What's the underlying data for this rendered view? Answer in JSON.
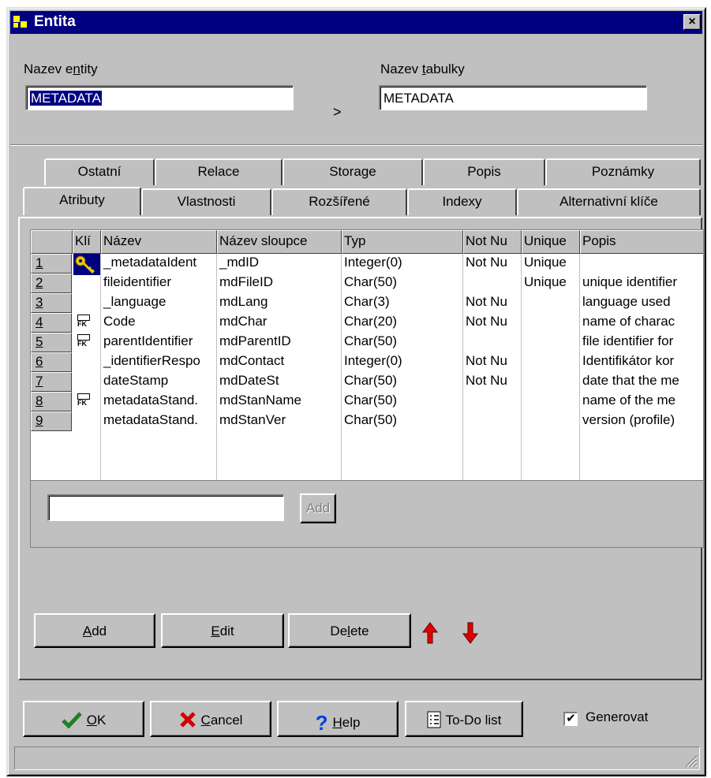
{
  "window": {
    "title": "Entita",
    "close": "×"
  },
  "form": {
    "entity_label_pre": "Nazev e",
    "entity_label_key": "n",
    "entity_label_post": "tity",
    "entity_value": "METADATA",
    "table_label_pre": "Nazev ",
    "table_label_key": "t",
    "table_label_post": "abulky",
    "table_value": "METADATA",
    "arrow": ">"
  },
  "tabs_row1": [
    "Ostatní",
    "Relace",
    "Storage",
    "Popis",
    "Poznámky"
  ],
  "tabs_row2": [
    "Atributy",
    "Vlastnosti",
    "Rozšířené",
    "Indexy",
    "Alternativní klíče"
  ],
  "grid": {
    "headers": [
      "Klí",
      "Název",
      "Název sloupce",
      "Typ",
      "Not Nu",
      "Unique",
      "Popis"
    ],
    "rows": [
      {
        "n": "1",
        "name": "_metadataIdent",
        "col": "_mdID",
        "type": "Integer(0)",
        "notnull": "Not Nu",
        "unique": "Unique",
        "desc": ""
      },
      {
        "n": "2",
        "name": "fileidentifier",
        "col": "mdFileID",
        "type": "Char(50)",
        "notnull": "",
        "unique": "Unique",
        "desc": "unique identifier"
      },
      {
        "n": "3",
        "name": "_language",
        "col": "mdLang",
        "type": "Char(3)",
        "notnull": "Not Nu",
        "unique": "",
        "desc": "language used"
      },
      {
        "n": "4",
        "name": "Code",
        "col": "mdChar",
        "type": "Char(20)",
        "notnull": "Not Nu",
        "unique": "",
        "desc": "name of charac"
      },
      {
        "n": "5",
        "name": "parentIdentifier",
        "col": "mdParentID",
        "type": "Char(50)",
        "notnull": "",
        "unique": "",
        "desc": "file identifier for"
      },
      {
        "n": "6",
        "name": "_identifierRespo",
        "col": "mdContact",
        "type": "Integer(0)",
        "notnull": "Not Nu",
        "unique": "",
        "desc": "Identifikátor kor"
      },
      {
        "n": "7",
        "name": "dateStamp",
        "col": "mdDateSt",
        "type": "Char(50)",
        "notnull": "Not Nu",
        "unique": "",
        "desc": "date that the me"
      },
      {
        "n": "8",
        "name": "metadataStand.",
        "col": "mdStanName",
        "type": "Char(50)",
        "notnull": "",
        "unique": "",
        "desc": "name of the me"
      },
      {
        "n": "9",
        "name": "metadataStand.",
        "col": "mdStanVer",
        "type": "Char(50)",
        "notnull": "",
        "unique": "",
        "desc": "version (profile)"
      }
    ],
    "fk_label": "FK",
    "quick_add_value": "",
    "quick_add_button": "Add"
  },
  "actions": {
    "add_pre": "",
    "add_key": "A",
    "add_post": "dd",
    "edit_pre": "",
    "edit_key": "E",
    "edit_post": "dit",
    "delete_pre": "De",
    "delete_key": "l",
    "delete_post": "ete"
  },
  "footer": {
    "ok_key": "O",
    "ok_post": "K",
    "cancel_key": "C",
    "cancel_post": "ancel",
    "help_key": "H",
    "help_post": "elp",
    "todo": "To-Do list",
    "generate_label": "Generovat",
    "generate_checked": "✔"
  },
  "colors": {
    "titlebar": "#000080",
    "face": "#c0c0c0",
    "arrow": "#e00000"
  }
}
